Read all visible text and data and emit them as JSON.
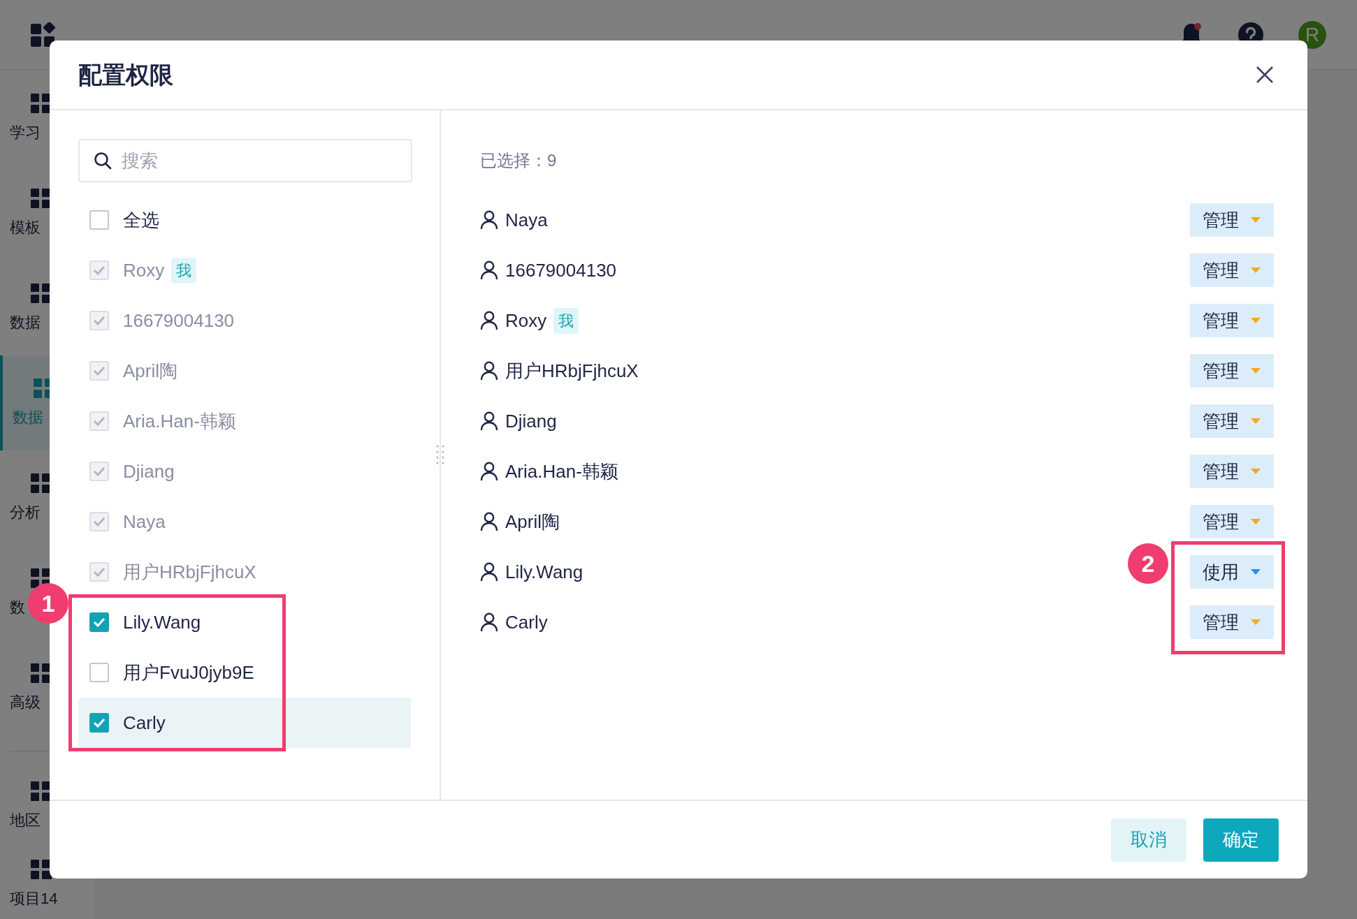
{
  "app": {
    "avatar": "R",
    "notification_dot": true,
    "sidebar": [
      {
        "label": "学习",
        "selected": false
      },
      {
        "label": "模板",
        "selected": false
      },
      {
        "label": "数据",
        "selected": false
      },
      {
        "label": "数据",
        "selected": true
      },
      {
        "label": "分析",
        "selected": false
      },
      {
        "label": "数",
        "selected": false
      },
      {
        "label": "高级",
        "selected": false
      },
      {
        "label": "地区",
        "selected": false
      },
      {
        "label": "项目14",
        "selected": false
      }
    ]
  },
  "dialog": {
    "title": "配置权限",
    "search": {
      "placeholder": "搜索"
    },
    "select_all": {
      "label": "全选",
      "checked": false
    },
    "members": [
      {
        "name": "Roxy",
        "tag": "我",
        "checked": true,
        "disabled": true,
        "highlighted": false
      },
      {
        "name": "16679004130",
        "checked": true,
        "disabled": true,
        "highlighted": false
      },
      {
        "name": "April陶",
        "checked": true,
        "disabled": true,
        "highlighted": false
      },
      {
        "name": "Aria.Han-韩颖",
        "checked": true,
        "disabled": true,
        "highlighted": false
      },
      {
        "name": "Djiang",
        "checked": true,
        "disabled": true,
        "highlighted": false
      },
      {
        "name": "Naya",
        "checked": true,
        "disabled": true,
        "highlighted": false
      },
      {
        "name": "用户HRbjFjhcuX",
        "checked": true,
        "disabled": true,
        "highlighted": false
      },
      {
        "name": "Lily.Wang",
        "checked": true,
        "disabled": false,
        "highlighted": false
      },
      {
        "name": "用户FvuJ0jyb9E",
        "checked": false,
        "disabled": false,
        "highlighted": false
      },
      {
        "name": "Carly",
        "checked": true,
        "disabled": false,
        "highlighted": true
      }
    ],
    "selected_count": "已选择：9",
    "permissions": [
      {
        "name": "Naya",
        "role": "管理",
        "kind": "manage"
      },
      {
        "name": "16679004130",
        "role": "管理",
        "kind": "manage"
      },
      {
        "name": "Roxy",
        "tag": "我",
        "role": "管理",
        "kind": "manage"
      },
      {
        "name": "用户HRbjFjhcuX",
        "role": "管理",
        "kind": "manage"
      },
      {
        "name": "Djiang",
        "role": "管理",
        "kind": "manage"
      },
      {
        "name": "Aria.Han-韩颖",
        "role": "管理",
        "kind": "manage"
      },
      {
        "name": "April陶",
        "role": "管理",
        "kind": "manage"
      },
      {
        "name": "Lily.Wang",
        "role": "使用",
        "kind": "use"
      },
      {
        "name": "Carly",
        "role": "管理",
        "kind": "manage"
      }
    ],
    "cancel": "取消",
    "confirm": "确定"
  },
  "annotations": [
    "1",
    "2"
  ]
}
